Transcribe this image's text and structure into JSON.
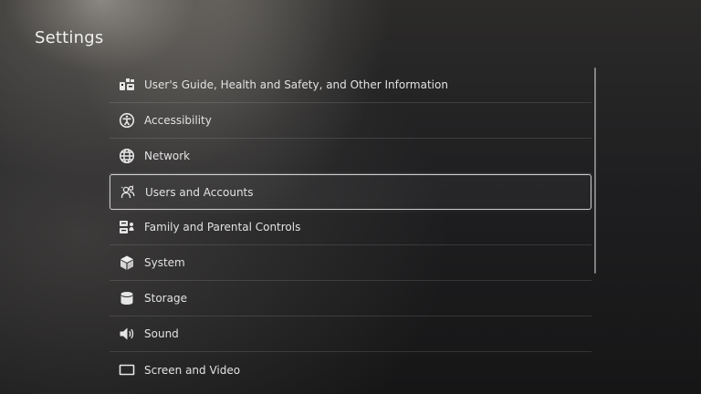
{
  "header": {
    "title": "Settings"
  },
  "menu": {
    "items": [
      {
        "label": "User's Guide, Health and Safety, and Other Information",
        "icon": "guide-icon"
      },
      {
        "label": "Accessibility",
        "icon": "accessibility-icon"
      },
      {
        "label": "Network",
        "icon": "globe-icon"
      },
      {
        "label": "Users and Accounts",
        "icon": "users-icon",
        "selected": true
      },
      {
        "label": "Family and Parental Controls",
        "icon": "family-icon"
      },
      {
        "label": "System",
        "icon": "cube-icon"
      },
      {
        "label": "Storage",
        "icon": "database-icon"
      },
      {
        "label": "Sound",
        "icon": "speaker-icon"
      },
      {
        "label": "Screen and Video",
        "icon": "screen-icon"
      }
    ]
  }
}
